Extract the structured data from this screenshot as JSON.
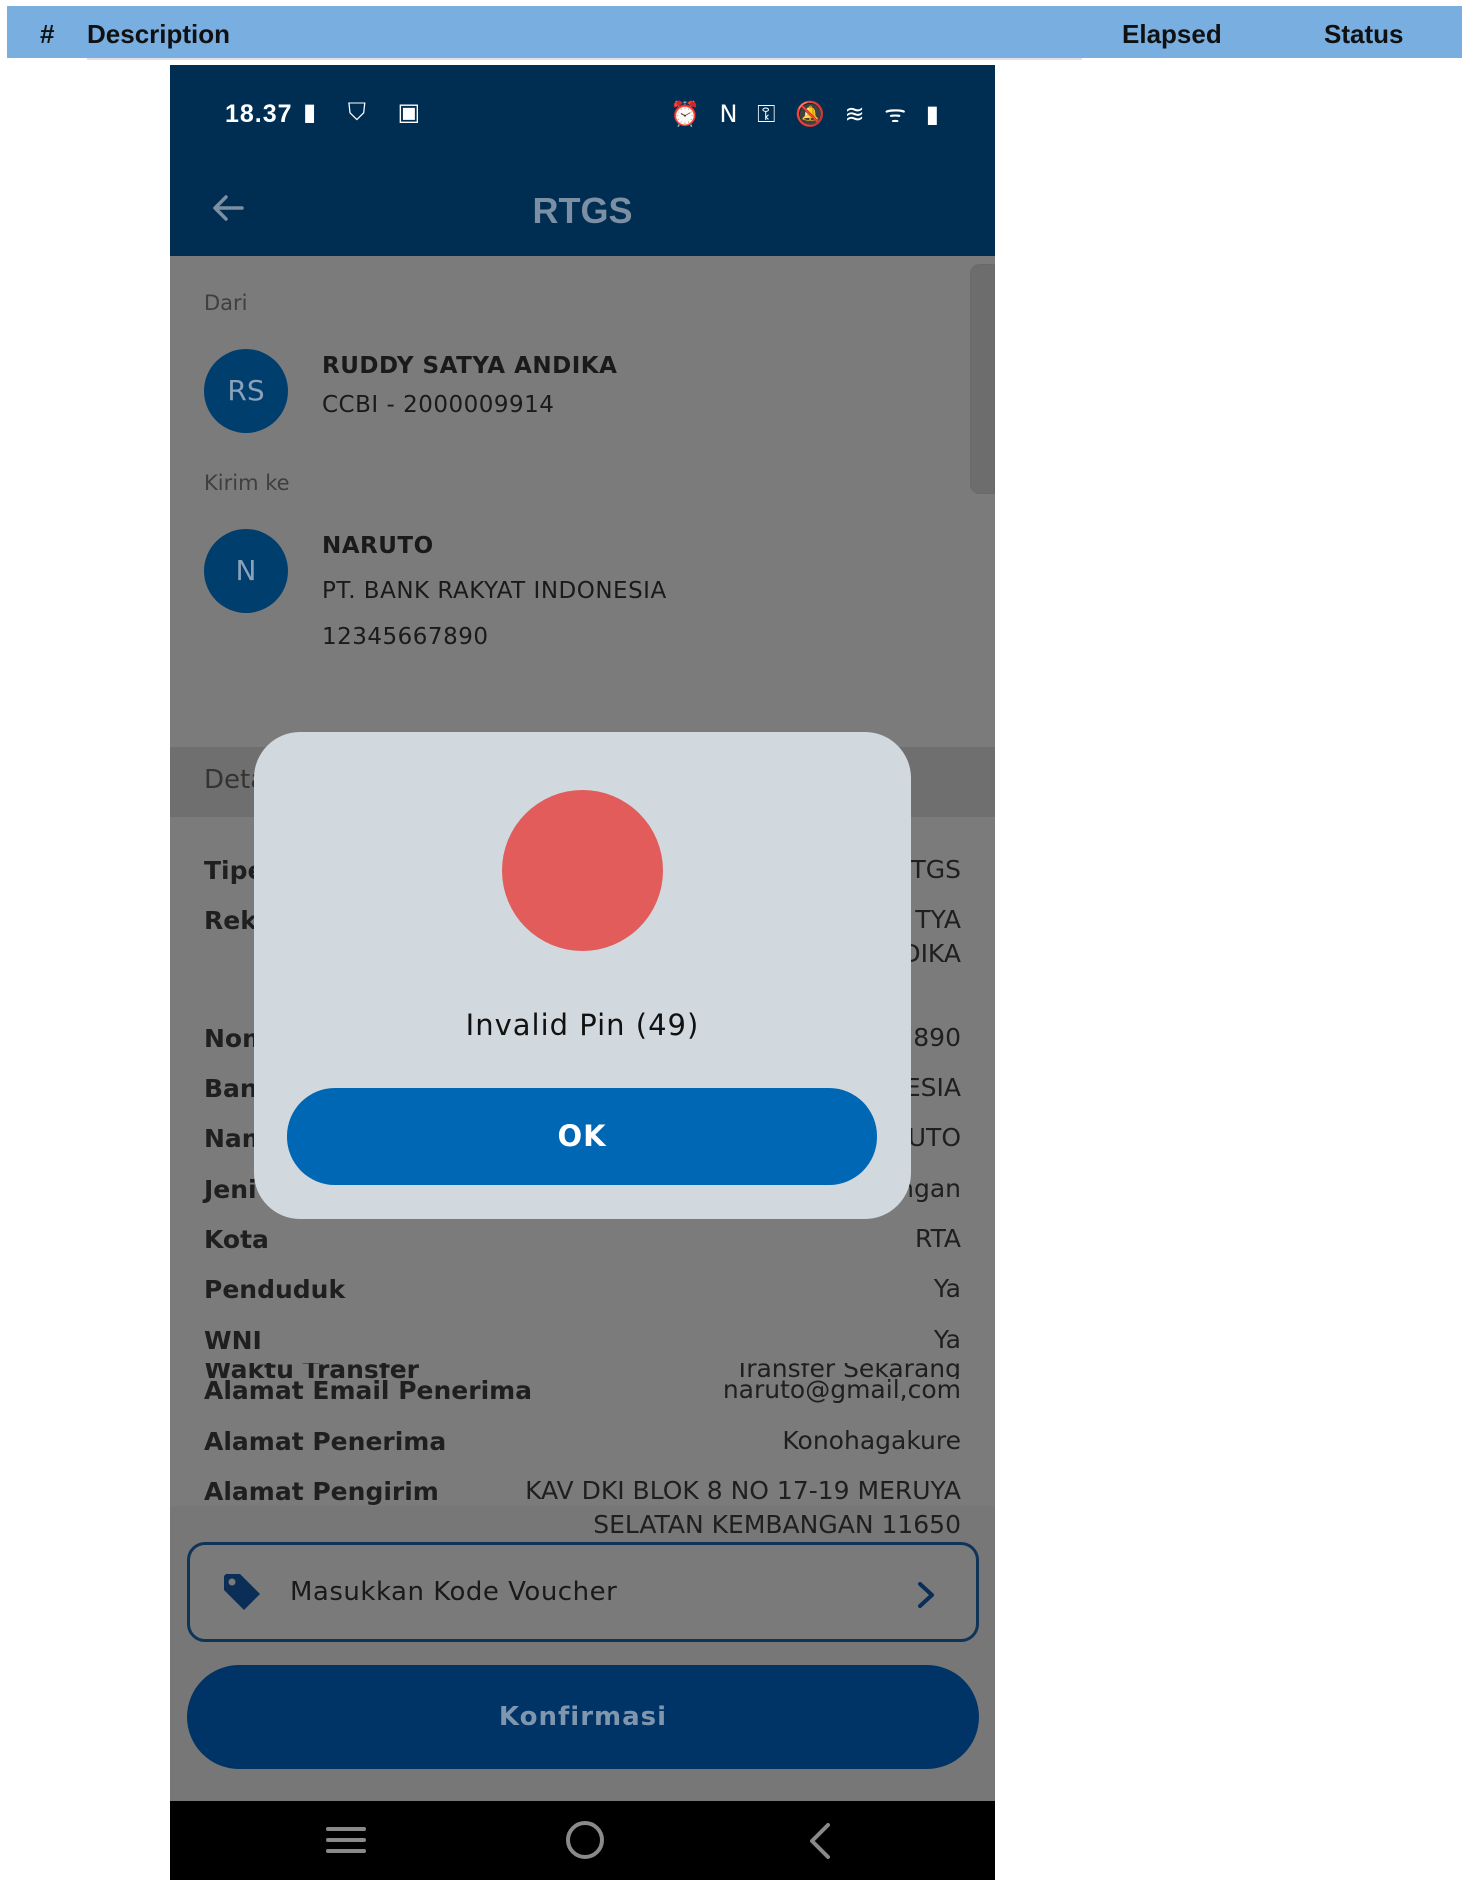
{
  "report": {
    "hash": "#",
    "description": "Description",
    "elapsed": "Elapsed",
    "status": "Status"
  },
  "statusbar": {
    "time": "18.37",
    "left_icons": "▮ ⛉ ▣",
    "right_icons": "⏰ N ⚿ 🔕 ≋ ᯤ ▮"
  },
  "appbar": {
    "title": "RTGS"
  },
  "from": {
    "label": "Dari",
    "initials": "RS",
    "name": "RUDDY SATYA ANDIKA",
    "account": "CCBI - 2000009914"
  },
  "to": {
    "label": "Kirim ke",
    "initials": "N",
    "name": "NARUTO",
    "bank": "PT. BANK RAKYAT INDONESIA",
    "account": "12345667890"
  },
  "detail": {
    "title": "Detail Transfer",
    "rows": [
      {
        "label": "Tipe",
        "value": "TGS"
      },
      {
        "label": "Reke",
        "value": "TYA\nDIKA"
      },
      {
        "label": "Nom",
        "value": "7890"
      },
      {
        "label": "Banl",
        "value": "ESIA"
      },
      {
        "label": "Nam",
        "value": "UTO"
      },
      {
        "label": "Jeni",
        "value": "ngan"
      },
      {
        "label": "Kota",
        "value": "RTA"
      },
      {
        "label": "Penduduk",
        "value": "Ya"
      },
      {
        "label": "WNI",
        "value": "Ya"
      },
      {
        "label": "Alamat Email Penerima",
        "value": "naruto@gmail,com"
      },
      {
        "label": "Alamat Penerima",
        "value": "Konohagakure"
      },
      {
        "label": "Alamat Pengirim",
        "value": "KAV DKI BLOK 8 NO 17-19 MERUYA\nSELATAN KEMBANGAN 11650"
      },
      {
        "label": "Waktu Transfer",
        "value": "Transfer Sekarang"
      }
    ]
  },
  "voucher": {
    "label": "Masukkan Kode Voucher"
  },
  "confirm": {
    "label": "Konfirmasi"
  },
  "dialog": {
    "message": "Invalid Pin (49)",
    "ok_label": "OK",
    "color": "#e25c5b"
  }
}
